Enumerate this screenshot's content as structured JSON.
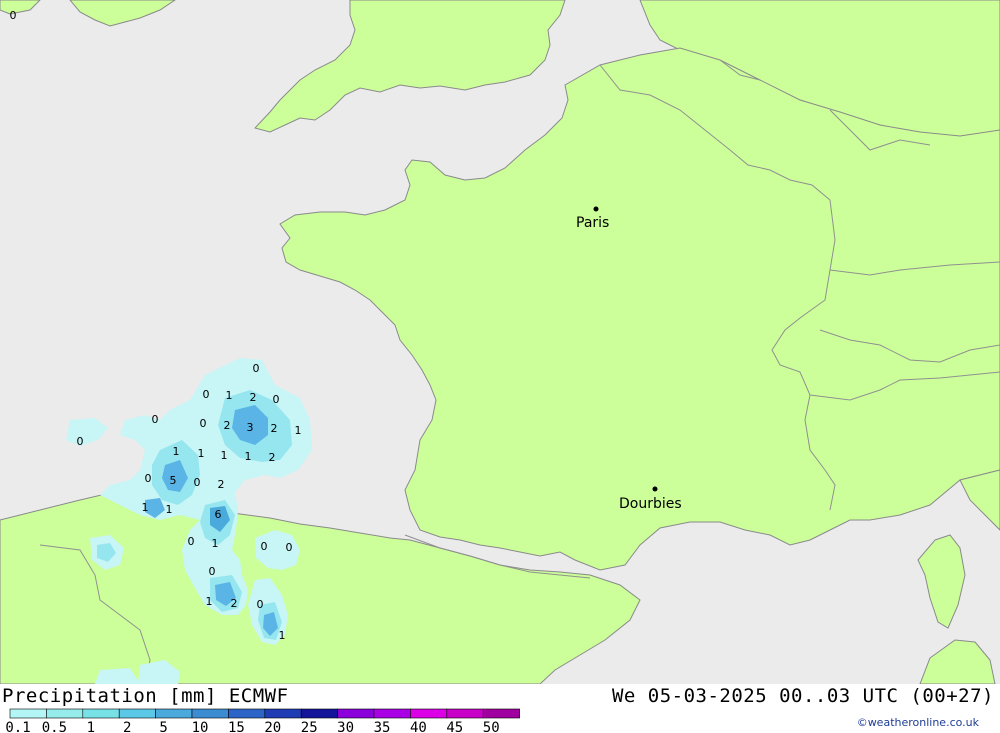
{
  "footer": {
    "title": "Precipitation [mm] ECMWF",
    "datetime": "We 05-03-2025 00..03 UTC (00+27)",
    "credit": "©weatheronline.co.uk"
  },
  "legend": {
    "labels": [
      "0.1",
      "0.5",
      "1",
      "2",
      "5",
      "10",
      "15",
      "20",
      "25",
      "30",
      "35",
      "40",
      "45",
      "50"
    ],
    "colors": [
      "#b4f5f5",
      "#96ebeb",
      "#78e1e6",
      "#5ac8e6",
      "#4baadc",
      "#3c8cd2",
      "#2d64c8",
      "#1e3cb4",
      "#14149b",
      "#8c00dc",
      "#aa00e6",
      "#dc00e6",
      "#c800c8",
      "#a000a0"
    ]
  },
  "colors": {
    "sea": "#ebebeb",
    "land": "#ccff99",
    "border": "#909090",
    "precip_light": "#c8f5f5",
    "precip_mid": "#96e6f0",
    "precip_heavy": "#5ab4e6"
  },
  "places": [
    {
      "name": "Paris"
    },
    {
      "name": "Dourbies"
    }
  ],
  "precip_values": [
    "0",
    "0",
    "1",
    "2",
    "0",
    "0",
    "0",
    "2",
    "3",
    "2",
    "1",
    "0",
    "1",
    "1",
    "1",
    "1",
    "2",
    "0",
    "5",
    "0",
    "2",
    "1",
    "1",
    "6",
    "0",
    "1",
    "0",
    "0",
    "0",
    "1",
    "2",
    "0",
    "1",
    "0"
  ]
}
